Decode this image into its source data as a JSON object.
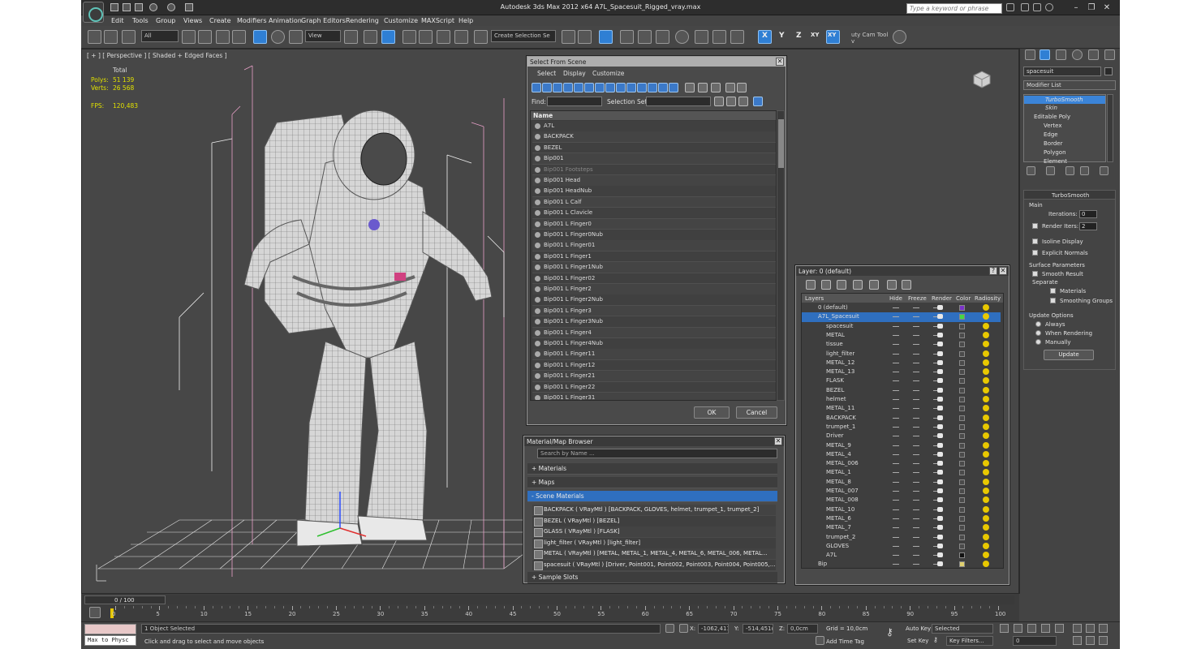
{
  "app": {
    "title": "Autodesk 3ds Max  2012 x64     A7L_Spacesuit_Rigged_vray.max",
    "search_placeholder": "Type a keyword or phrase"
  },
  "menu": [
    "Edit",
    "Tools",
    "Group",
    "Views",
    "Create",
    "Modifiers",
    "Animation",
    "Graph Editors",
    "Rendering",
    "Customize",
    "MAXScript",
    "Help"
  ],
  "toolbar": {
    "filter": "All",
    "ref_coord": "View",
    "selection_set": "Create Selection Se",
    "axis_x": "X",
    "axis_y": "Y",
    "axis_z": "Z",
    "axis_xy": "XY",
    "axis_xy2": "XY",
    "plugin": "uty Cam Tool v"
  },
  "viewport": {
    "label": "[ + ] [ Perspective ] [ Shaded + Edged Faces ]",
    "total_label": "Total",
    "polys_label": "Polys:",
    "polys": "51 139",
    "verts_label": "Verts:",
    "verts": "26 568",
    "fps_label": "FPS:",
    "fps": "120,483"
  },
  "select_dialog": {
    "title": "Select From Scene",
    "menus": [
      "Select",
      "Display",
      "Customize"
    ],
    "find_label": "Find:",
    "selset_label": "Selection Set:",
    "column": "Name",
    "items": [
      "A7L",
      "BACKPACK",
      "BEZEL",
      "Bip001",
      "Bip001 Footsteps",
      "Bip001 Head",
      "Bip001 HeadNub",
      "Bip001 L Calf",
      "Bip001 L Clavicle",
      "Bip001 L Finger0",
      "Bip001 L Finger0Nub",
      "Bip001 L Finger01",
      "Bip001 L Finger1",
      "Bip001 L Finger1Nub",
      "Bip001 L Finger02",
      "Bip001 L Finger2",
      "Bip001 L Finger2Nub",
      "Bip001 L Finger3",
      "Bip001 L Finger3Nub",
      "Bip001 L Finger4",
      "Bip001 L Finger4Nub",
      "Bip001 L Finger11",
      "Bip001 L Finger12",
      "Bip001 L Finger21",
      "Bip001 L Finger22",
      "Bip001 L Finger31"
    ],
    "ok": "OK",
    "cancel": "Cancel"
  },
  "material_browser": {
    "title": "Material/Map Browser",
    "search_placeholder": "Search by Name ...",
    "cat_materials": "+ Materials",
    "cat_maps": "+ Maps",
    "cat_scene": "- Scene Materials",
    "cat_samples": "+ Sample Slots",
    "materials": [
      "BACKPACK  ( VRayMtl )  [BACKPACK, GLOVES, helmet, trumpet_1, trumpet_2]",
      "BEZEL  ( VRayMtl )  [BEZEL]",
      "GLASS  ( VRayMtl )  [FLASK]",
      "light_filter  ( VRayMtl )  [light_filter]",
      "METAL  ( VRayMtl )  [METAL, METAL_1, METAL_4, METAL_6, METAL_006, METAL...",
      "spacesuit  ( VRayMtl )  [Driver, Point001, Point002, Point003, Point004, Point005,..."
    ]
  },
  "layer_dialog": {
    "title": "Layer: 0 (default)",
    "help": "?",
    "columns": [
      "Layers",
      "Hide",
      "Freeze",
      "Render",
      "Color",
      "Radiosity"
    ],
    "layers": [
      {
        "name": "0 (default)",
        "color": "#7a32c8"
      },
      {
        "name": "A7L_Spacesuit",
        "color": "#44d844"
      },
      {
        "name": "spacesuit",
        "color": "#4a4a4a"
      },
      {
        "name": "METAL",
        "color": "#4a4a4a"
      },
      {
        "name": "tissue",
        "color": "#4a4a4a"
      },
      {
        "name": "light_filter",
        "color": "#4a4a4a"
      },
      {
        "name": "METAL_12",
        "color": "#4a4a4a"
      },
      {
        "name": "METAL_13",
        "color": "#4a4a4a"
      },
      {
        "name": "FLASK",
        "color": "#4a4a4a"
      },
      {
        "name": "BEZEL",
        "color": "#4a4a4a"
      },
      {
        "name": "helmet",
        "color": "#4a4a4a"
      },
      {
        "name": "METAL_11",
        "color": "#4a4a4a"
      },
      {
        "name": "BACKPACK",
        "color": "#4a4a4a"
      },
      {
        "name": "trumpet_1",
        "color": "#4a4a4a"
      },
      {
        "name": "Driver",
        "color": "#4a4a4a"
      },
      {
        "name": "METAL_9",
        "color": "#4a4a4a"
      },
      {
        "name": "METAL_4",
        "color": "#4a4a4a"
      },
      {
        "name": "METAL_006",
        "color": "#4a4a4a"
      },
      {
        "name": "METAL_1",
        "color": "#4a4a4a"
      },
      {
        "name": "METAL_8",
        "color": "#4a4a4a"
      },
      {
        "name": "METAL_007",
        "color": "#4a4a4a"
      },
      {
        "name": "METAL_008",
        "color": "#4a4a4a"
      },
      {
        "name": "METAL_10",
        "color": "#4a4a4a"
      },
      {
        "name": "METAL_6",
        "color": "#4a4a4a"
      },
      {
        "name": "METAL_7",
        "color": "#4a4a4a"
      },
      {
        "name": "trumpet_2",
        "color": "#4a4a4a"
      },
      {
        "name": "GLOVES",
        "color": "#4a4a4a"
      },
      {
        "name": "A7L",
        "color": "#111111"
      },
      {
        "name": "Bip",
        "color": "#e0d070"
      }
    ]
  },
  "command_panel": {
    "object_name": "spacesuit",
    "modifier_list": "Modifier List",
    "stack": [
      "TurboSmooth",
      "Skin",
      "Editable Poly",
      "Vertex",
      "Edge",
      "Border",
      "Polygon",
      "Element"
    ],
    "rollout_title": "TurboSmooth",
    "main": "Main",
    "iterations_label": "Iterations:",
    "iterations": "0",
    "render_iters_label": "Render Iters:",
    "render_iters": "2",
    "isoline": "Isoline Display",
    "explicit": "Explicit Normals",
    "surface_params": "Surface Parameters",
    "smooth_result": "Smooth Result",
    "separate": "Separate",
    "materials": "Materials",
    "smoothing_groups": "Smoothing Groups",
    "update_options": "Update Options",
    "always": "Always",
    "when_rendering": "When Rendering",
    "manually": "Manually",
    "update": "Update"
  },
  "timeline": {
    "frame": "0 / 100",
    "ticks": [
      "0",
      "5",
      "10",
      "15",
      "20",
      "25",
      "30",
      "35",
      "40",
      "45",
      "50",
      "55",
      "60",
      "65",
      "70",
      "75",
      "80",
      "85",
      "90",
      "95",
      "100"
    ]
  },
  "status": {
    "maxscript": "Max to Physc",
    "selected": "1 Object Selected",
    "prompt": "Click and drag to select and move objects",
    "x_label": "X:",
    "x": "-1062,411c",
    "y_label": "Y:",
    "y": "-514,451c",
    "z_label": "Z:",
    "z": "0,0cm",
    "grid": "Grid = 10,0cm",
    "add_time_tag": "Add Time Tag",
    "auto_key": "Auto Key",
    "set_key": "Set Key",
    "key_mode": "Selected",
    "key_filters": "Key Filters...",
    "current_frame": "0"
  }
}
